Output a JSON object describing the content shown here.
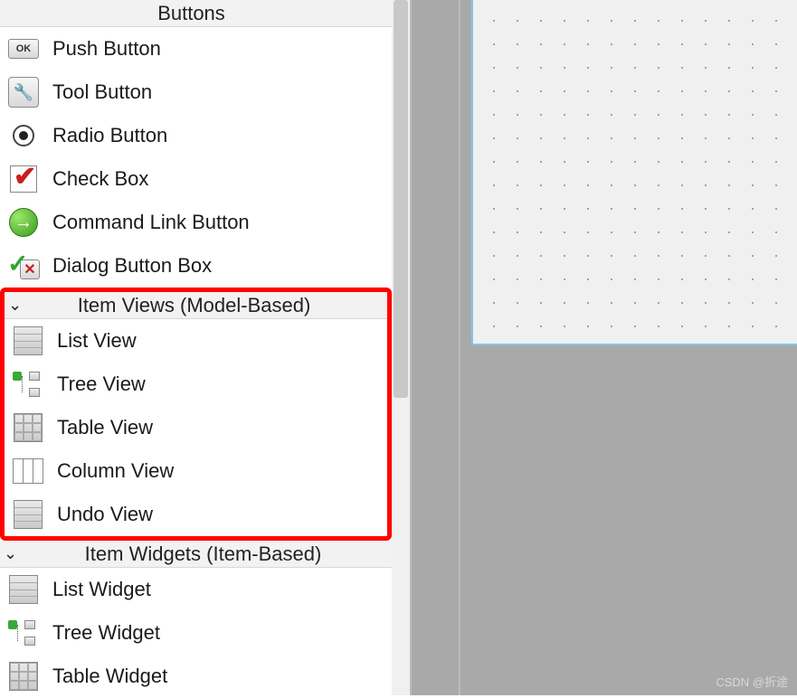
{
  "sections": {
    "buttons": {
      "header": "Buttons",
      "items": [
        {
          "label": "Push Button",
          "icon": "ok"
        },
        {
          "label": "Tool Button",
          "icon": "wrench"
        },
        {
          "label": "Radio Button",
          "icon": "radio"
        },
        {
          "label": "Check Box",
          "icon": "check"
        },
        {
          "label": "Command Link Button",
          "icon": "arrow"
        },
        {
          "label": "Dialog Button Box",
          "icon": "dlg"
        }
      ]
    },
    "item_views": {
      "header": "Item Views (Model-Based)",
      "items": [
        {
          "label": "List View",
          "icon": "list"
        },
        {
          "label": "Tree View",
          "icon": "tree"
        },
        {
          "label": "Table View",
          "icon": "table"
        },
        {
          "label": "Column View",
          "icon": "column"
        },
        {
          "label": "Undo View",
          "icon": "list"
        }
      ]
    },
    "item_widgets": {
      "header": "Item Widgets (Item-Based)",
      "items": [
        {
          "label": "List Widget",
          "icon": "list"
        },
        {
          "label": "Tree Widget",
          "icon": "tree"
        },
        {
          "label": "Table Widget",
          "icon": "table"
        }
      ]
    }
  },
  "watermark": "CSDN @折途"
}
